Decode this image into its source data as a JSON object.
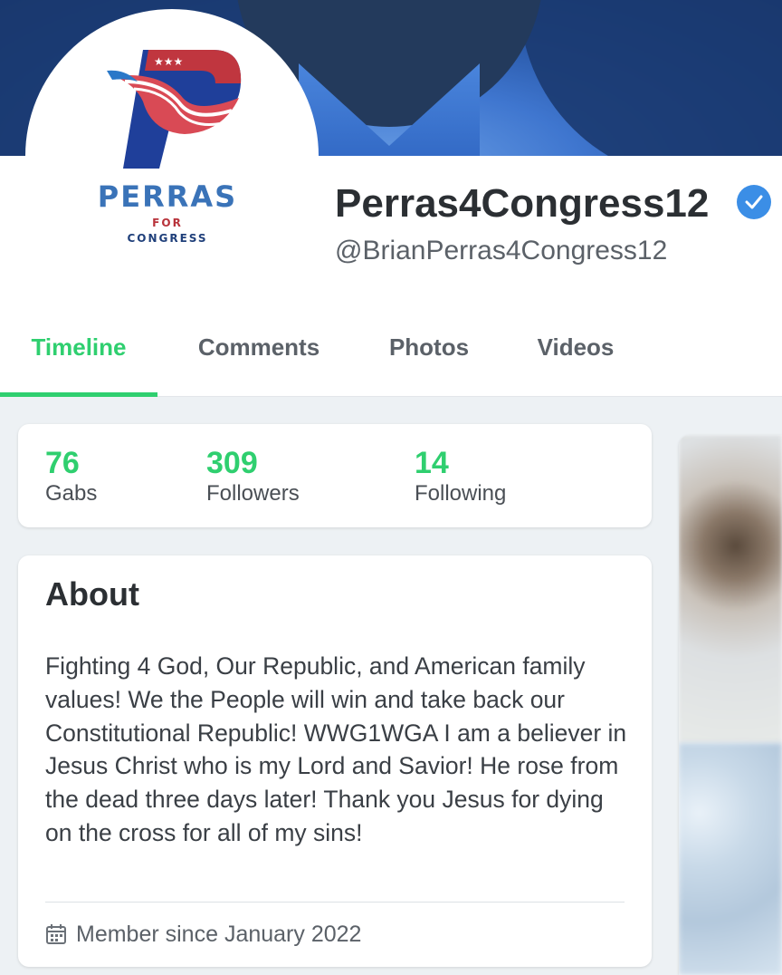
{
  "cover": {
    "colors": {
      "shirt": "#3f76cf",
      "suit": "#1b3a70"
    }
  },
  "avatar": {
    "brand_name": "PERRAS",
    "brand_for": "FOR",
    "brand_sub": "CONGRESS",
    "colors": {
      "blue": "#3a73b8",
      "red": "#b8323a",
      "navy": "#1f3f7a"
    }
  },
  "profile": {
    "display_name": "Perras4Congress12",
    "handle": "@BrianPerras4Congress12",
    "verified": true
  },
  "tabs": [
    {
      "label": "Timeline",
      "active": true
    },
    {
      "label": "Comments",
      "active": false
    },
    {
      "label": "Photos",
      "active": false
    },
    {
      "label": "Videos",
      "active": false
    }
  ],
  "stats": [
    {
      "value": "76",
      "label": "Gabs"
    },
    {
      "value": "309",
      "label": "Followers"
    },
    {
      "value": "14",
      "label": "Following"
    }
  ],
  "about": {
    "title": "About",
    "bio": "Fighting 4 God, Our Republic, and American family values! We the People will win and take back our Constitutional Republic! WWG1WGA I am a believer in Jesus Christ who is my Lord and Savior! He rose from the dead three days later! Thank you Jesus for dying on the cross for all of my sins!",
    "member_since": "Member since January 2022",
    "member_icon": "calendar-icon"
  },
  "theme": {
    "accent": "#2fcf6f",
    "verified_blue": "#3b8ee6"
  }
}
